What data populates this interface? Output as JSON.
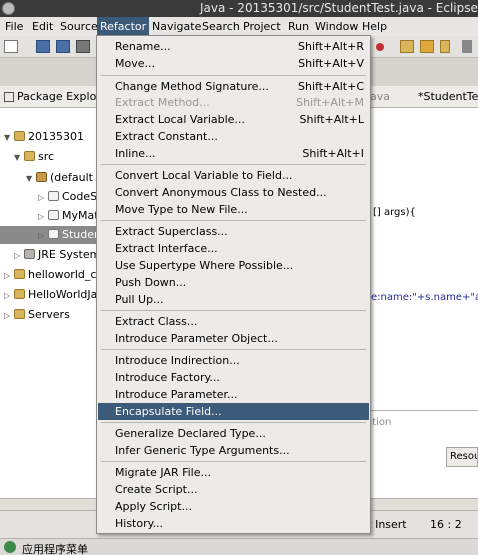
{
  "window": {
    "title": "Java - 20135301/src/StudentTest.java - Eclipse"
  },
  "menubar": [
    {
      "label": "File"
    },
    {
      "label": "Edit"
    },
    {
      "label": "Source"
    },
    {
      "label": "Refactor"
    },
    {
      "label": "Navigate"
    },
    {
      "label": "Search"
    },
    {
      "label": "Project"
    },
    {
      "label": "Run"
    },
    {
      "label": "Window"
    },
    {
      "label": "Help"
    }
  ],
  "refactor_menu": {
    "items": [
      {
        "label": "Rename...",
        "shortcut": "Shift+Alt+R"
      },
      {
        "label": "Move...",
        "shortcut": "Shift+Alt+V"
      },
      {
        "label": "Change Method Signature...",
        "shortcut": "Shift+Alt+C"
      },
      {
        "label": "Extract Method...",
        "shortcut": "Shift+Alt+M",
        "disabled": true
      },
      {
        "label": "Extract Local Variable...",
        "shortcut": "Shift+Alt+L"
      },
      {
        "label": "Extract Constant..."
      },
      {
        "label": "Inline...",
        "shortcut": "Shift+Alt+I"
      },
      {
        "label": "Convert Local Variable to Field..."
      },
      {
        "label": "Convert Anonymous Class to Nested..."
      },
      {
        "label": "Move Type to New File..."
      },
      {
        "label": "Extract Superclass..."
      },
      {
        "label": "Extract Interface..."
      },
      {
        "label": "Use Supertype Where Possible..."
      },
      {
        "label": "Push Down..."
      },
      {
        "label": "Pull Up..."
      },
      {
        "label": "Extract Class..."
      },
      {
        "label": "Introduce Parameter Object..."
      },
      {
        "label": "Introduce Indirection..."
      },
      {
        "label": "Introduce Factory..."
      },
      {
        "label": "Introduce Parameter..."
      },
      {
        "label": "Encapsulate Field...",
        "highlighted": true
      },
      {
        "label": "Generalize Declared Type..."
      },
      {
        "label": "Infer Generic Type Arguments..."
      },
      {
        "label": "Migrate JAR File..."
      },
      {
        "label": "Create Script..."
      },
      {
        "label": "Apply Script..."
      },
      {
        "label": "History..."
      }
    ]
  },
  "package_explorer": {
    "tab_label": "Package Explorer",
    "tree": [
      {
        "label": "20135301"
      },
      {
        "label": "src"
      },
      {
        "label": "(default p"
      },
      {
        "label": "CodeSt"
      },
      {
        "label": "MyMat"
      },
      {
        "label": "Studen"
      },
      {
        "label": "JRE System L"
      },
      {
        "label": "helloworld_c"
      },
      {
        "label": "HelloWorldJava"
      },
      {
        "label": "Servers"
      }
    ]
  },
  "editor": {
    "tabs": [
      "ava",
      "*StudentTest"
    ],
    "code": [
      "[] args){",
      "e:name:\"+s.name+\"age"
    ]
  },
  "bottom_panel": {
    "hint": "ation",
    "resources_tab": "Resou"
  },
  "status": {
    "insert": "art Insert",
    "position": "16 : 2"
  },
  "taskbar": {
    "label": "应用程序菜单"
  },
  "colors": {
    "highlight": "#3c5a7a",
    "menu_bg": "#edebe7",
    "titlebar": "#3a3a3a"
  }
}
